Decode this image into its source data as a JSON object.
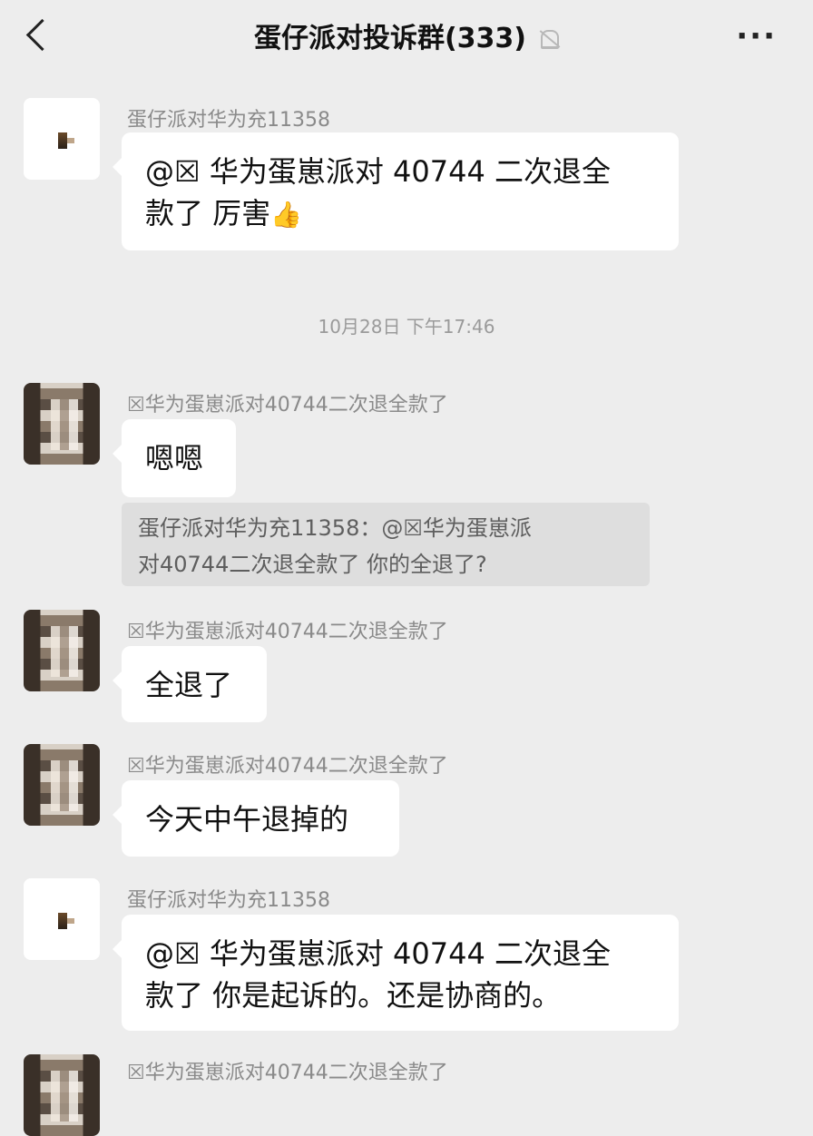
{
  "header": {
    "back_label": "<",
    "title": "蛋仔派对投诉群(333)",
    "more_label": "···"
  },
  "messages": [
    {
      "sender": "蛋仔派对华为充11358",
      "text_line1": "@☒ 华为蛋崽派对 40744 二次退全",
      "text_line2": "款了  厉害",
      "emoji": "👍"
    },
    {
      "sender": "☒华为蛋崽派对40744二次退全款了",
      "text": "嗯嗯",
      "quote_line1": "蛋仔派对华为充11358：@☒华为蛋崽派",
      "quote_line2": "对40744二次退全款了 你的全退了?"
    },
    {
      "sender": "☒华为蛋崽派对40744二次退全款了",
      "text": "全退了"
    },
    {
      "sender": "☒华为蛋崽派对40744二次退全款了",
      "text": "今天中午退掉的"
    },
    {
      "sender": "蛋仔派对华为充11358",
      "text_line1": "@☒ 华为蛋崽派对 40744 二次退全",
      "text_line2": "款了  你是起诉的。还是协商的。"
    },
    {
      "sender": "☒华为蛋崽派对40744二次退全款了"
    }
  ],
  "timestamp": "10月28日 下午17:46"
}
